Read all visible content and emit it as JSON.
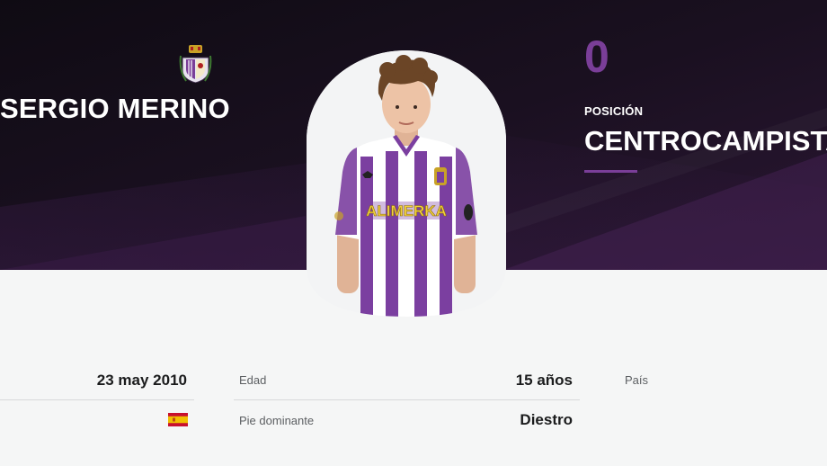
{
  "player": {
    "name": "SERGIO MERINO",
    "number": "0",
    "position_label": "POSICIÓN",
    "position_value": "CENTROCAMPISTA",
    "photo_sponsor": "ALIMERKA"
  },
  "stats": {
    "birthdate": "23 may 2010",
    "age_label": "Edad",
    "age_value": "15 años",
    "country_label": "País",
    "foot_label": "Pie dominante",
    "foot_value": "Diestro"
  },
  "colors": {
    "accent": "#7a3e98",
    "hero_bg": "#130e17"
  },
  "icons": {
    "club_crest": "club-crest-icon",
    "country_flag": "spain-flag-icon"
  }
}
